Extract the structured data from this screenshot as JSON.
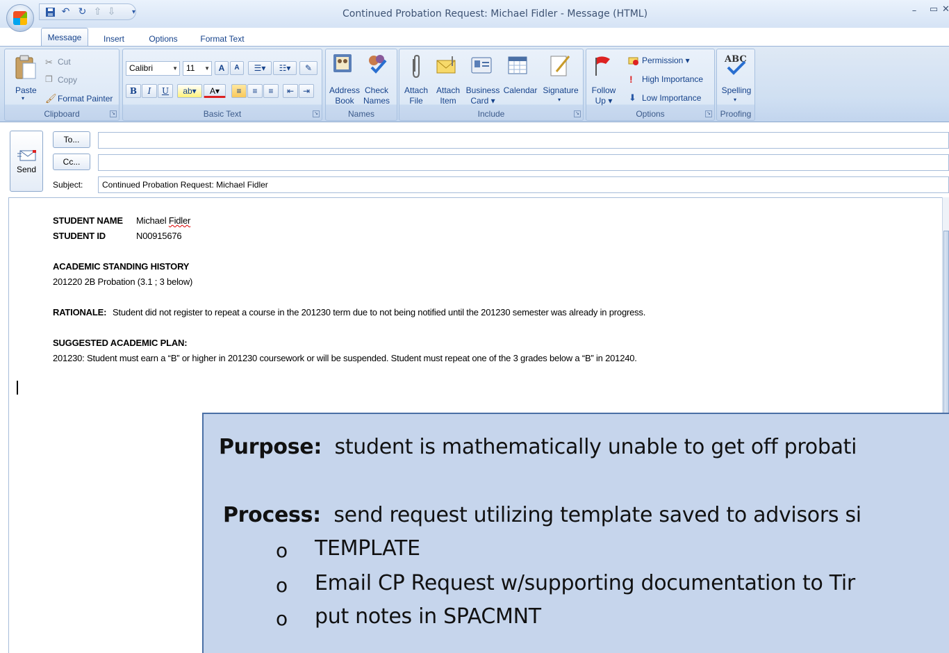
{
  "window": {
    "title": "Continued Probation Request: Michael Fidler - Message (HTML)",
    "minimize": "–",
    "maximize": "▭",
    "close": "✕"
  },
  "tabs": [
    "Message",
    "Insert",
    "Options",
    "Format Text"
  ],
  "ribbon": {
    "clipboard": {
      "label": "Clipboard",
      "paste": "Paste",
      "cut": "Cut",
      "copy": "Copy",
      "format_painter": "Format Painter"
    },
    "basic_text": {
      "label": "Basic Text",
      "font": "Calibri",
      "size": "11",
      "bold": "B",
      "italic": "I",
      "underline": "U"
    },
    "names": {
      "label": "Names",
      "address_book_1": "Address",
      "address_book_2": "Book",
      "check_names_1": "Check",
      "check_names_2": "Names"
    },
    "include": {
      "label": "Include",
      "attach_file_1": "Attach",
      "attach_file_2": "File",
      "attach_item_1": "Attach",
      "attach_item_2": "Item",
      "business_card_1": "Business",
      "business_card_2": "Card ▾",
      "calendar": "Calendar",
      "signature": "Signature"
    },
    "options": {
      "label": "Options",
      "follow_up_1": "Follow",
      "follow_up_2": "Up ▾",
      "permission": "Permission ▾",
      "high_importance": "High Importance",
      "low_importance": "Low Importance"
    },
    "proofing": {
      "label": "Proofing",
      "spelling": "Spelling"
    }
  },
  "compose": {
    "send": "Send",
    "to_button": "To...",
    "cc_button": "Cc...",
    "subject_label": "Subject:",
    "to_value": "",
    "cc_value": "",
    "subject_value": "Continued Probation Request: Michael Fidler"
  },
  "body": {
    "student_name_label": "STUDENT NAME",
    "student_name_first": "Michael",
    "student_name_last": "Fidler",
    "student_id_label": "STUDENT ID",
    "student_id_value": "N00915676",
    "history_heading": "ACADEMIC STANDING HISTORY",
    "history_line": "201220  2B Probation (3.1 ; 3 below)",
    "rationale_label": "RATIONALE:",
    "rationale_text": "Student did not register to repeat a course in the 201230 term due to not being notified until the 201230 semester was already in progress.",
    "plan_heading": "SUGGESTED ACADEMIC PLAN:",
    "plan_text": "201230: Student must earn a  “B” or higher in 201230 coursework or will be suspended.  Student must repeat one of the 3 grades below a “B” in 201240."
  },
  "overlay": {
    "purpose_label": "Purpose:",
    "purpose_text": "student is mathematically unable to get off probati",
    "process_label": "Process:",
    "process_text": "send request utilizing template saved to advisors si",
    "bullets": [
      "TEMPLATE",
      "Email CP Request w/supporting documentation to Tir",
      "put notes in SPACMNT"
    ],
    "bullet_glyph": "o"
  },
  "colors": {
    "ribbon": "#cfdff2",
    "overlay": "#c6d5ec",
    "tab_text": "#15428b"
  }
}
